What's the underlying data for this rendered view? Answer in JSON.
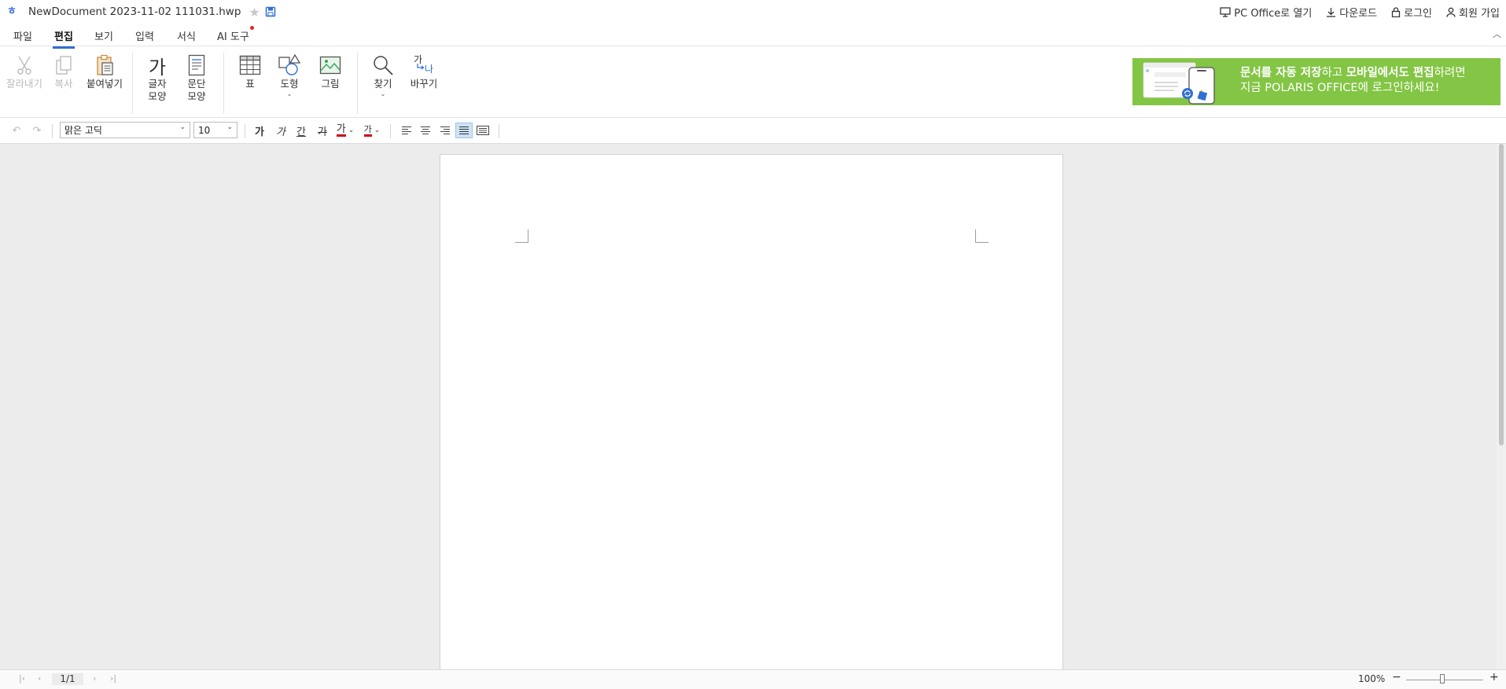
{
  "titlebar": {
    "doc_title": "NewDocument 2023-11-02 111031.hwp",
    "links": [
      {
        "label": "PC Office로 열기",
        "icon": "monitor-icon"
      },
      {
        "label": "다운로드",
        "icon": "download-icon"
      },
      {
        "label": "로그인",
        "icon": "lock-icon"
      },
      {
        "label": "회원 가입",
        "icon": "user-icon"
      }
    ]
  },
  "tabs": [
    {
      "label": "파일"
    },
    {
      "label": "편집",
      "active": true
    },
    {
      "label": "보기"
    },
    {
      "label": "입력"
    },
    {
      "label": "서식"
    },
    {
      "label": "AI 도구",
      "badge": true
    }
  ],
  "ribbon": {
    "cut": "잘라내기",
    "copy": "복사",
    "paste": "붙여넣기",
    "char_glyph": "가",
    "char_shape": [
      "글자",
      "모양"
    ],
    "para_shape": [
      "문단",
      "모양"
    ],
    "table": "표",
    "shape": "도형",
    "picture": "그림",
    "find": "찾기",
    "replace": "바꾸기",
    "replace_glyph_top": "가",
    "replace_glyph_bottom": "나"
  },
  "banner": {
    "line1": [
      {
        "text": "문서를 자동 저장",
        "bold": true
      },
      {
        "text": "하고 ",
        "bold": false
      },
      {
        "text": "모바일에서도 편집",
        "bold": true
      },
      {
        "text": "하려면",
        "bold": false
      }
    ],
    "line2": "지금 POLARIS OFFICE에 로그인하세요!"
  },
  "format": {
    "font_name": "맑은 고딕",
    "font_size": "10",
    "bold_glyph": "가",
    "italic_glyph": "가",
    "underline_glyph": "간",
    "strike_glyph": "가",
    "color_glyph": "가",
    "highlight_glyph": "가"
  },
  "status": {
    "page_indicator": "1/1",
    "zoom": "100%",
    "zoom_level_fraction": 0.47
  },
  "colors": {
    "accent": "#2f6fd8",
    "banner_green": "#83c544",
    "font_color_underline": "#d0021b"
  }
}
